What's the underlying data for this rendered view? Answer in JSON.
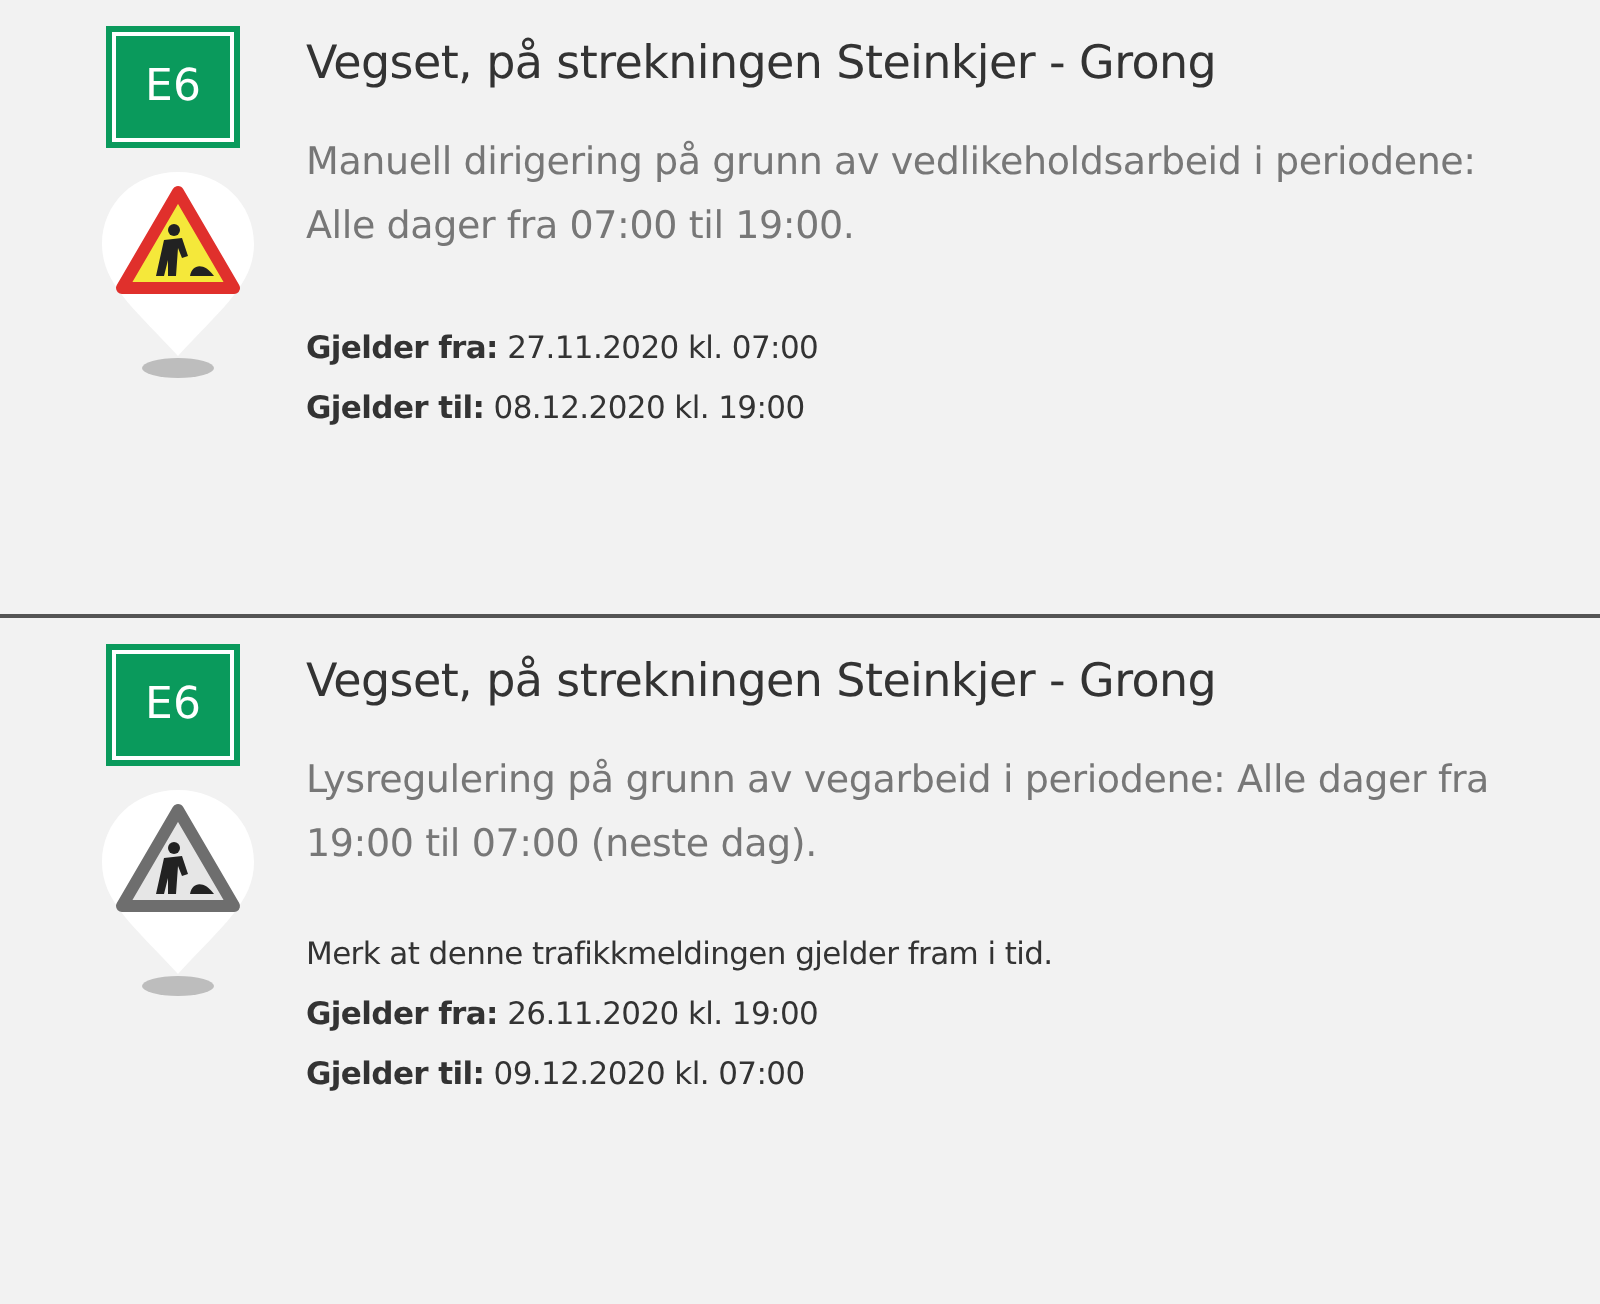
{
  "messages": [
    {
      "road": "E6",
      "kind": "active",
      "title": "Vegset, på strekningen Steinkjer - Grong",
      "description": "Manuell dirigering på grunn av vedlikeholdsarbeid i periodene: Alle dager fra 07:00 til 19:00.",
      "lines": [
        "**Gjelder fra:** 27.11.2020 kl. 07:00",
        "**Gjelder til:** 08.12.2020 kl. 19:00"
      ]
    },
    {
      "road": "E6",
      "kind": "future",
      "title": "Vegset, på strekningen Steinkjer - Grong",
      "description": "Lysregulering på grunn av vegarbeid i periodene: Alle dager fra 19:00 til 07:00 (neste dag).",
      "lines": [
        "Merk at denne trafikkmeldingen gjelder fram i tid.",
        "**Gjelder fra:** 26.11.2020 kl. 19:00",
        "**Gjelder til:** 09.12.2020 kl. 07:00"
      ]
    }
  ]
}
